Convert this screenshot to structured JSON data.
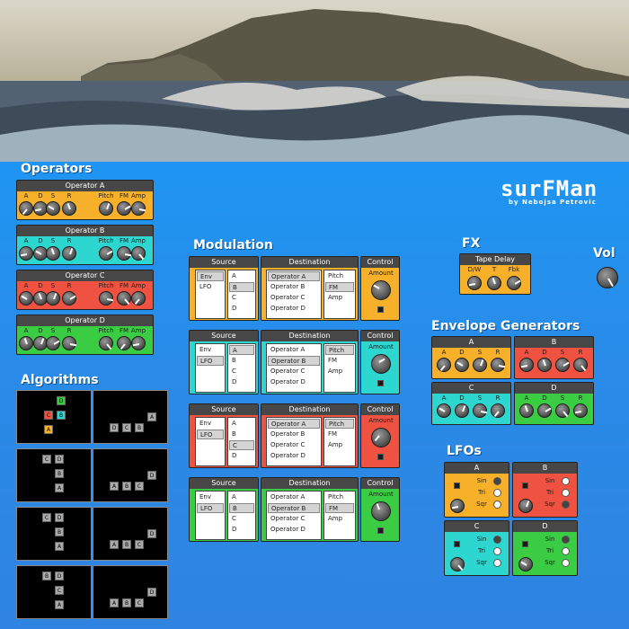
{
  "app": {
    "title": "surFMan",
    "author": "by Nebojsa Petrovic"
  },
  "sections": {
    "operators": "Operators",
    "algorithms": "Algorithms",
    "modulation": "Modulation",
    "fx": "FX",
    "vol": "Vol",
    "envelope": "Envelope Generators",
    "lfos": "LFOs"
  },
  "operators": [
    {
      "name": "Operator A",
      "color": "#f6b02a"
    },
    {
      "name": "Operator B",
      "color": "#2dd6cf"
    },
    {
      "name": "Operator C",
      "color": "#ef5240"
    },
    {
      "name": "Operator D",
      "color": "#3acd43"
    }
  ],
  "op_labels": [
    "A",
    "D",
    "S",
    "R",
    "Pitch",
    "FM",
    "Amp"
  ],
  "modulation_headers": {
    "source": "Source",
    "destination": "Destination",
    "control": "Control",
    "amount": "Amount"
  },
  "sources": [
    "Env",
    "LFO"
  ],
  "source_ops": [
    "A",
    "B",
    "C",
    "D"
  ],
  "dest_ops": [
    "Operator A",
    "Operator B",
    "Operator C",
    "Operator D"
  ],
  "dest_params": [
    "Pitch",
    "FM",
    "Amp"
  ],
  "mod_slots": [
    {
      "color": "#f6b02a",
      "source": "Env",
      "op": "B",
      "dest": "Operator A",
      "param": "FM"
    },
    {
      "color": "#2dd6cf",
      "source": "LFO",
      "op": "A",
      "dest": "Operator B",
      "param": "Pitch"
    },
    {
      "color": "#ef5240",
      "source": "LFO",
      "op": "C",
      "dest": "Operator A",
      "param": "Pitch"
    },
    {
      "color": "#3acd43",
      "source": "LFO",
      "op": "B",
      "dest": "Operator B",
      "param": "FM"
    }
  ],
  "fx": {
    "title": "Tape Delay",
    "labels": [
      "D/W",
      "T",
      "Fbk"
    ]
  },
  "env_gens": [
    {
      "name": "A",
      "color": "#f6b02a"
    },
    {
      "name": "B",
      "color": "#ef5240"
    },
    {
      "name": "C",
      "color": "#2dd6cf"
    },
    {
      "name": "D",
      "color": "#3acd43"
    }
  ],
  "env_labels": [
    "A",
    "D",
    "S",
    "R"
  ],
  "lfos": [
    {
      "name": "A",
      "color": "#f6b02a",
      "wave": "Sin"
    },
    {
      "name": "B",
      "color": "#ef5240",
      "wave": "Sqr"
    },
    {
      "name": "C",
      "color": "#2dd6cf",
      "wave": "Sin"
    },
    {
      "name": "D",
      "color": "#3acd43",
      "wave": "Sin"
    }
  ],
  "lfo_waves": [
    "Sin",
    "Tri",
    "Sqr"
  ],
  "algorithms": [
    [
      "D",
      "B",
      "C",
      "A"
    ],
    [
      "D",
      "C",
      "B",
      "A"
    ],
    [
      "C",
      "D",
      "B",
      "A"
    ],
    [
      "A",
      "B",
      "C",
      "D"
    ],
    [
      "C",
      "D",
      "B",
      "A"
    ],
    [
      "A",
      "B",
      "C",
      "D"
    ],
    [
      "B",
      "D",
      "C",
      "A"
    ],
    [
      "A",
      "B",
      "C",
      "D"
    ]
  ]
}
